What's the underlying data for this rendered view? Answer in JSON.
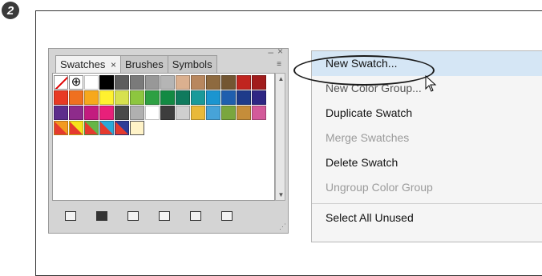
{
  "step_badge": "2",
  "panel": {
    "tabs": [
      {
        "label": "Swatches",
        "close": "×",
        "active": true
      },
      {
        "label": "Brushes",
        "active": false
      },
      {
        "label": "Symbols",
        "active": false
      }
    ],
    "minimize": "–",
    "close": "×",
    "menu_button": "≡"
  },
  "swatches": {
    "row1": [
      "none",
      "registration",
      "#ffffff",
      "#000000",
      "#5d5d5d",
      "#7a7a7a",
      "#989898",
      "#b5b5b5",
      "#dbb08f",
      "#b8875e",
      "#8e6a3f",
      "#735632",
      "#c0251f",
      "#a11c1c"
    ],
    "row2": [
      "#e83a24",
      "#ef7020",
      "#f7a81b",
      "#fff12f",
      "#d7e14f",
      "#8dc63f",
      "#2ea043",
      "#128a43",
      "#0f7a5d",
      "#1a9a9a",
      "#1b95d0",
      "#1f5fae",
      "#1e3b8a",
      "#2e2784"
    ],
    "row3": [
      "#5d2d8c",
      "#8e2b8b",
      "#c31b7f",
      "#e8207a",
      "#4a4a4a",
      "#b0b0b0",
      "#ffffff",
      "#3d3d3d",
      "#cfcfcf",
      "#e8b93a",
      "#47a3d8",
      "#7aa63e",
      "#c58d3a",
      "#d35a9a"
    ],
    "row4": [
      "#f29a1f",
      "#f6e21b",
      "#65b547",
      "#2aa9d9",
      "#2e3d96",
      "folder"
    ]
  },
  "menu": {
    "items": [
      {
        "label": "New Swatch...",
        "state": "highlight"
      },
      {
        "label": "New Color Group...",
        "state": "normal"
      },
      {
        "label": "Duplicate Swatch",
        "state": "normal"
      },
      {
        "label": "Merge Swatches",
        "state": "disabled"
      },
      {
        "label": "Delete Swatch",
        "state": "normal"
      },
      {
        "label": "Ungroup Color Group",
        "state": "disabled"
      },
      {
        "label": "Select All Unused",
        "state": "normal"
      }
    ]
  },
  "icons": {
    "footer": [
      "swatch-libraries-menu-icon",
      "show-swatch-kinds-icon",
      "swatch-options-icon",
      "new-color-group-icon",
      "new-swatch-icon",
      "delete-swatch-icon"
    ]
  }
}
